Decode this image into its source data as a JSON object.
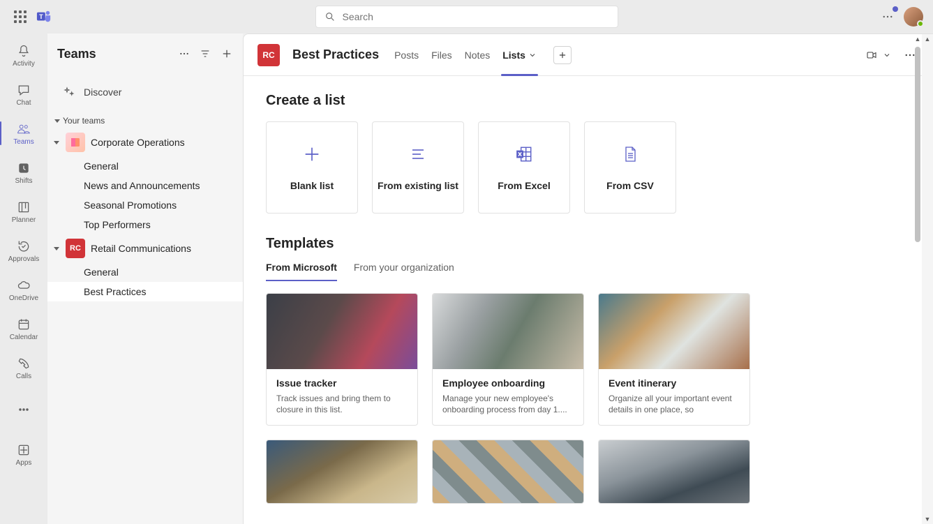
{
  "search": {
    "placeholder": "Search"
  },
  "rail": {
    "activity": "Activity",
    "chat": "Chat",
    "teams": "Teams",
    "shifts": "Shifts",
    "planner": "Planner",
    "approvals": "Approvals",
    "onedrive": "OneDrive",
    "calendar": "Calendar",
    "calls": "Calls",
    "apps": "Apps"
  },
  "panel": {
    "title": "Teams",
    "discover": "Discover",
    "yourTeams": "Your teams",
    "teams": [
      {
        "name": "Corporate Operations",
        "avatar": "",
        "avatarClass": "ta-pink",
        "channels": [
          "General",
          "News and Announcements",
          "Seasonal Promotions",
          "Top Performers"
        ]
      },
      {
        "name": "Retail Communications",
        "avatar": "RC",
        "avatarClass": "ta-red",
        "channels": [
          "General",
          "Best Practices"
        ]
      }
    ],
    "activeTeam": 1,
    "activeChannel": "Best Practices"
  },
  "content": {
    "channelAvatar": "RC",
    "channelTitle": "Best Practices",
    "tabs": [
      "Posts",
      "Files",
      "Notes",
      "Lists"
    ],
    "activeTab": "Lists",
    "createHeading": "Create a list",
    "createOptions": [
      {
        "label": "Blank list",
        "icon": "plus"
      },
      {
        "label": "From existing list",
        "icon": "list"
      },
      {
        "label": "From Excel",
        "icon": "excel"
      },
      {
        "label": "From CSV",
        "icon": "csv"
      }
    ],
    "templatesHeading": "Templates",
    "templateTabs": [
      "From Microsoft",
      "From your organization"
    ],
    "templateActive": "From Microsoft",
    "templates": [
      {
        "title": "Issue tracker",
        "desc": "Track issues and bring them to closure in this list."
      },
      {
        "title": "Employee onboarding",
        "desc": "Manage your new employee's onboarding process from day 1...."
      },
      {
        "title": "Event itinerary",
        "desc": "Organize all your important event details in one place, so everything..."
      }
    ]
  }
}
